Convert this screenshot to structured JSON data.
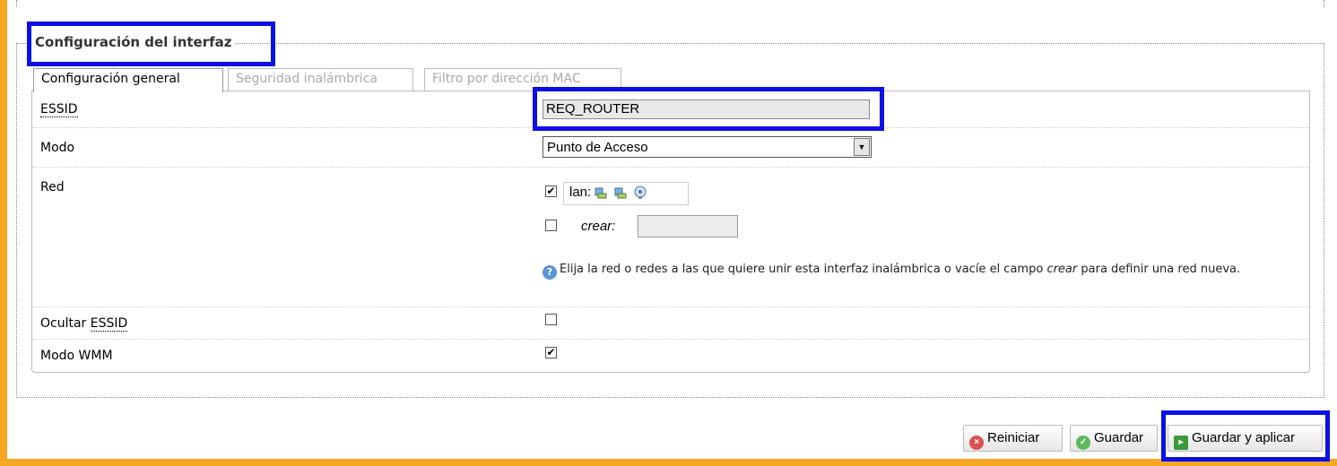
{
  "section": {
    "legend": "Configuración del interfaz"
  },
  "tabs": [
    {
      "label": "Configuración general",
      "active": true
    },
    {
      "label": "Seguridad inalámbrica",
      "active": false
    },
    {
      "label": "Filtro por dirección MAC",
      "active": false
    }
  ],
  "fields": {
    "essid": {
      "label": "ESSID",
      "value": "REQ_ROUTER"
    },
    "modo": {
      "label": "Modo",
      "value": "Punto de Acceso"
    },
    "red": {
      "label": "Red",
      "lan_checked": true,
      "lan_label": "lan:",
      "crear_checked": false,
      "crear_label": "crear:",
      "crear_value": "",
      "help_before": "Elija la red o redes a las que quiere unir esta interfaz inalámbrica o vacíe el campo",
      "help_em": "crear",
      "help_after": "para definir una red nueva."
    },
    "ocultar_essid": {
      "label_prefix": "Ocultar",
      "label_abbr": "ESSID",
      "checked": false
    },
    "modo_wmm": {
      "label": "Modo WMM",
      "checked": true
    }
  },
  "buttons": {
    "reset": "Reiniciar",
    "save": "Guardar",
    "save_apply": "Guardar y aplicar"
  },
  "colors": {
    "highlight": "#0a10e6",
    "accent": "#f5a623"
  }
}
